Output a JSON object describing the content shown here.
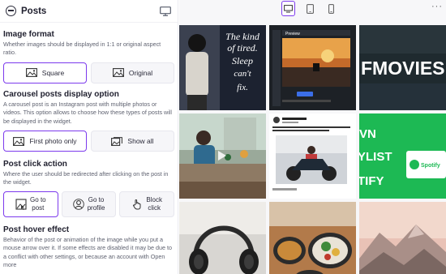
{
  "panel": {
    "title": "Posts",
    "sections": {
      "image_format": {
        "title": "Image format",
        "desc": "Whether images should be displayed in 1:1 or original aspect ratio.",
        "options": [
          "Square",
          "Original"
        ],
        "selected": "Square"
      },
      "carousel": {
        "title": "Carousel posts display option",
        "desc": "A carousel post is an Instagram post with multiple photos or videos. This option allows to choose how these types of posts will be displayed in the widget.",
        "options": [
          "First photo only",
          "Show all"
        ],
        "selected": "First photo only"
      },
      "click_action": {
        "title": "Post click action",
        "desc": "Where the user should be redirected after clicking on the post in the widget.",
        "options": [
          {
            "l1": "Go to",
            "l2": "post"
          },
          {
            "l1": "Go to",
            "l2": "profile"
          },
          {
            "l1": "Block",
            "l2": "click"
          }
        ],
        "selected": "Go to post"
      },
      "hover": {
        "title": "Post hover effect",
        "desc": "Behavior of the post or animation of the image while you put a mouse arrow over it. If some effects are disabled it may be due to a conflict with other settings, or because an account with Open more"
      }
    }
  },
  "preview": {
    "devices": [
      "desktop",
      "tablet",
      "mobile"
    ],
    "active_device": "desktop",
    "more_label": "···",
    "tiles": {
      "t1": {
        "quote": [
          "The kind",
          "of tired.",
          "Sleep",
          "can't",
          "fix."
        ]
      },
      "t2": {
        "caption": "Preview"
      },
      "t3": {
        "line1": "FMOVIES"
      },
      "t5": {
        "lines": [
          "VN",
          "YLIST",
          "TIFY"
        ],
        "badge": "Spotify"
      }
    }
  },
  "colors": {
    "accent": "#7c3aed",
    "text": "#1f1f2e",
    "muted": "#5f6270",
    "option_bg": "#f6f6f9",
    "spotify_green": "#1db954"
  }
}
